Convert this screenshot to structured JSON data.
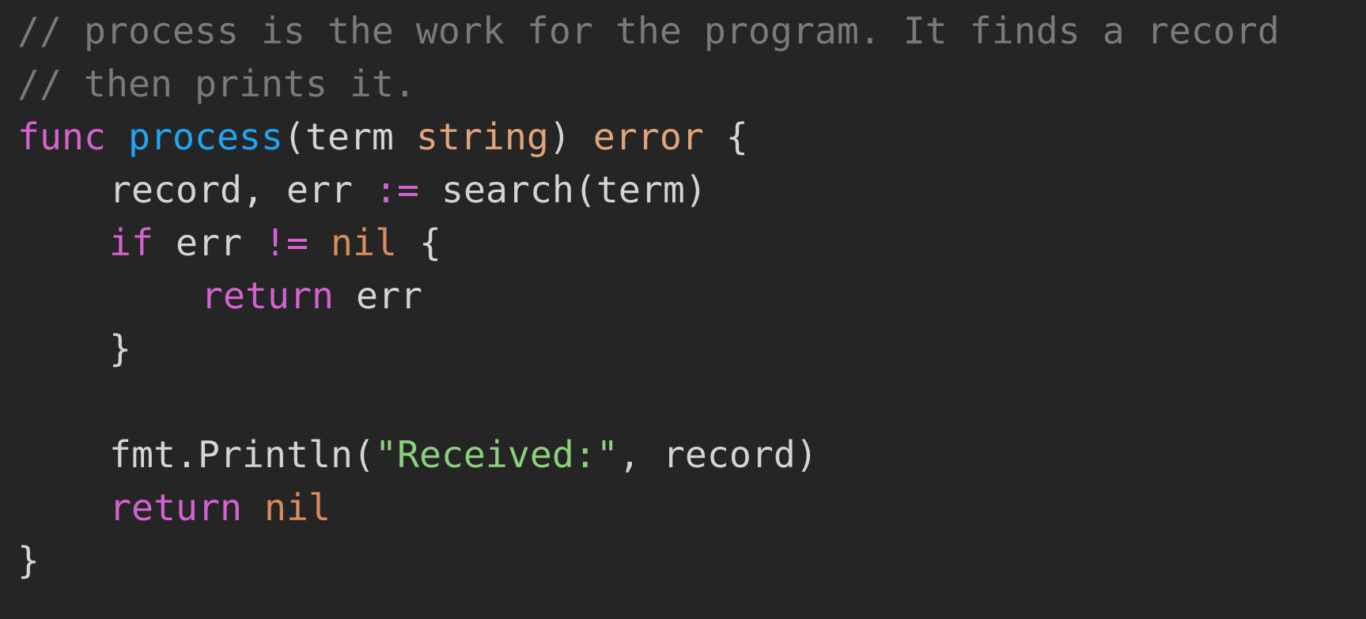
{
  "editor": {
    "background": "#252525",
    "colors": {
      "comment": "#7a7a7a",
      "keyword": "#d562d2",
      "function_name": "#1fa5f2",
      "type": "#e2a57b",
      "constant": "#d98c5e",
      "string": "#8bd07c",
      "plain": "#d4d4d4"
    },
    "lines": [
      {
        "tokens": [
          {
            "kind": "comment",
            "text": "// process is the work for the program. It finds a record"
          }
        ]
      },
      {
        "tokens": [
          {
            "kind": "comment",
            "text": "// then prints it."
          }
        ]
      },
      {
        "tokens": [
          {
            "kind": "keyword",
            "text": "func"
          },
          {
            "kind": "plain",
            "text": " "
          },
          {
            "kind": "funcname",
            "text": "process"
          },
          {
            "kind": "plain",
            "text": "(term "
          },
          {
            "kind": "type",
            "text": "string"
          },
          {
            "kind": "plain",
            "text": ") "
          },
          {
            "kind": "type",
            "text": "error"
          },
          {
            "kind": "plain",
            "text": " {"
          }
        ]
      },
      {
        "indent": 1,
        "tokens": [
          {
            "kind": "plain",
            "text": "record, err "
          },
          {
            "kind": "operator",
            "text": ":="
          },
          {
            "kind": "plain",
            "text": " search(term)"
          }
        ]
      },
      {
        "indent": 1,
        "tokens": [
          {
            "kind": "keyword",
            "text": "if"
          },
          {
            "kind": "plain",
            "text": " err "
          },
          {
            "kind": "operator",
            "text": "!="
          },
          {
            "kind": "plain",
            "text": " "
          },
          {
            "kind": "constant",
            "text": "nil"
          },
          {
            "kind": "plain",
            "text": " {"
          }
        ]
      },
      {
        "indent": 2,
        "tokens": [
          {
            "kind": "keyword",
            "text": "return"
          },
          {
            "kind": "plain",
            "text": " err"
          }
        ]
      },
      {
        "indent": 1,
        "tokens": [
          {
            "kind": "plain",
            "text": "}"
          }
        ]
      },
      {
        "tokens": []
      },
      {
        "indent": 1,
        "tokens": [
          {
            "kind": "plain",
            "text": "fmt.Println("
          },
          {
            "kind": "string",
            "text": "\"Received:\""
          },
          {
            "kind": "plain",
            "text": ", record)"
          }
        ]
      },
      {
        "indent": 1,
        "tokens": [
          {
            "kind": "keyword",
            "text": "return"
          },
          {
            "kind": "plain",
            "text": " "
          },
          {
            "kind": "constant",
            "text": "nil"
          }
        ]
      },
      {
        "tokens": [
          {
            "kind": "plain",
            "text": "}"
          }
        ]
      }
    ]
  }
}
